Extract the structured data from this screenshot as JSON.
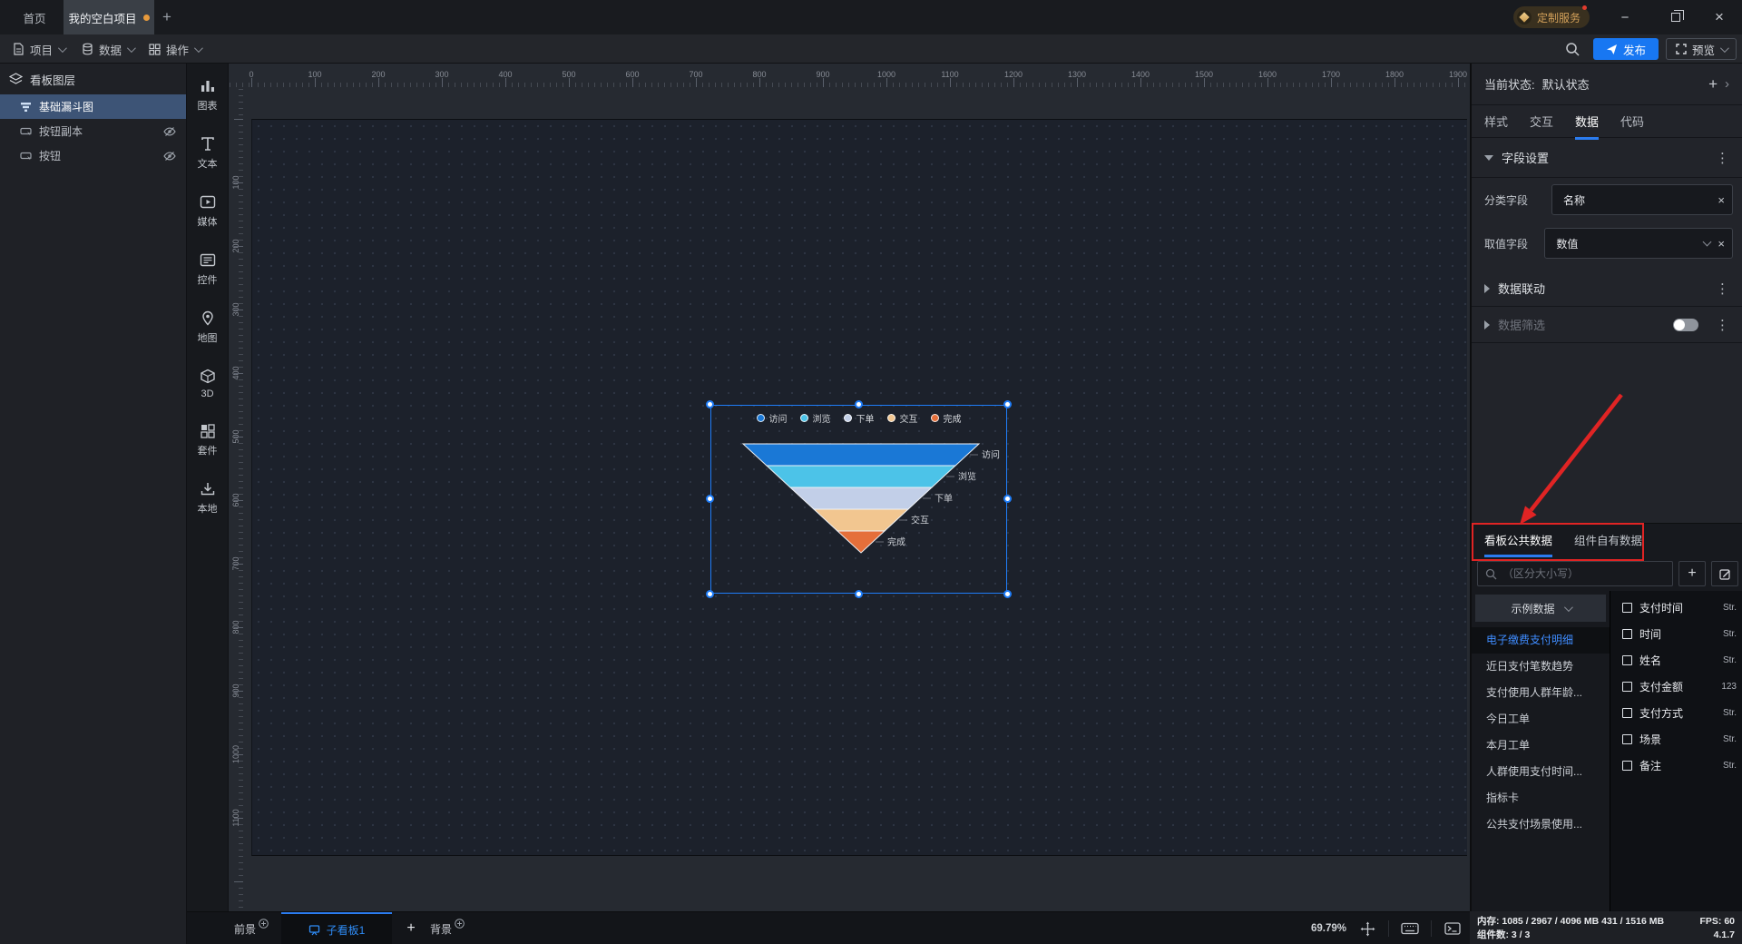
{
  "icons": {
    "plus": "+",
    "close": "×",
    "minimize": "−",
    "more": "⋮",
    "state_chevron": "›"
  },
  "titlebar": {
    "tabs": [
      {
        "label": "首页"
      },
      {
        "label": "我的空白项目"
      }
    ],
    "custom_service": "定制服务"
  },
  "menubar": {
    "project": "项目",
    "data": "数据",
    "operate": "操作",
    "publish": "发布",
    "preview": "预览"
  },
  "layers": {
    "title": "看板图层",
    "items": [
      {
        "label": "基础漏斗图",
        "selected": true,
        "hidden": false
      },
      {
        "label": "按钮副本",
        "selected": false,
        "hidden": true
      },
      {
        "label": "按钮",
        "selected": false,
        "hidden": true
      }
    ]
  },
  "toolbox": {
    "items": [
      {
        "label": "图表"
      },
      {
        "label": "文本"
      },
      {
        "label": "媒体"
      },
      {
        "label": "控件"
      },
      {
        "label": "地图"
      },
      {
        "label": "3D"
      },
      {
        "label": "套件"
      },
      {
        "label": "本地"
      }
    ]
  },
  "rulers": {
    "top": [
      "0",
      "100",
      "200",
      "300",
      "400",
      "500",
      "600",
      "700",
      "800",
      "900",
      "1000",
      "1100",
      "1200",
      "1300",
      "1400",
      "1500",
      "1600",
      "1700",
      "1800",
      "1900"
    ],
    "left": [
      "100",
      "200",
      "300",
      "400",
      "500",
      "600",
      "700",
      "800",
      "900",
      "1000",
      "1100"
    ]
  },
  "inspector": {
    "state_label": "当前状态:",
    "state_value": "默认状态",
    "tabs": [
      "样式",
      "交互",
      "数据",
      "代码"
    ],
    "active_tab": "数据",
    "field_settings": {
      "title": "字段设置",
      "category_label": "分类字段",
      "category_value": "名称",
      "value_label": "取值字段",
      "value_value": "数值"
    },
    "linkage": "数据联动",
    "filter": "数据筛选",
    "filter_enabled": false
  },
  "data_panel": {
    "tabs": [
      "看板公共数据",
      "组件自有数据"
    ],
    "active_tab": "看板公共数据",
    "search_placeholder": "（区分大小写）",
    "source": "示例数据",
    "datasets": [
      "电子缴费支付明细",
      "近日支付笔数趋势",
      "支付使用人群年龄...",
      "今日工单",
      "本月工单",
      "人群使用支付时间...",
      "指标卡",
      "公共支付场景使用..."
    ],
    "selected_dataset": "电子缴费支付明细",
    "fields": [
      {
        "name": "支付时间",
        "type": "Str."
      },
      {
        "name": "时间",
        "type": "Str."
      },
      {
        "name": "姓名",
        "type": "Str."
      },
      {
        "name": "支付金额",
        "type": "123"
      },
      {
        "name": "支付方式",
        "type": "Str."
      },
      {
        "name": "场景",
        "type": "Str."
      },
      {
        "name": "备注",
        "type": "Str."
      }
    ]
  },
  "bottombar": {
    "foreground": "前景",
    "board_tab": "子看板1",
    "background": "背景",
    "zoom": "69.79%"
  },
  "statusbar": {
    "memory": "内存: 1085 / 2967 / 4096 MB  431 / 1516 MB",
    "fps": "FPS: 60",
    "components": "组件数: 3 / 3",
    "version": "4.1.7"
  },
  "chart_data": {
    "type": "funnel",
    "title": "",
    "categories": [
      "访问",
      "浏览",
      "下单",
      "交互",
      "完成"
    ],
    "values": [
      100,
      80,
      60,
      40,
      20
    ],
    "values_estimated": true,
    "colors": [
      "#1a78d6",
      "#4cc3e8",
      "#c2cfe8",
      "#f2c690",
      "#e56f3a"
    ],
    "legend_position": "top",
    "label_position": "right",
    "orientation": "inverted-pyramid"
  }
}
